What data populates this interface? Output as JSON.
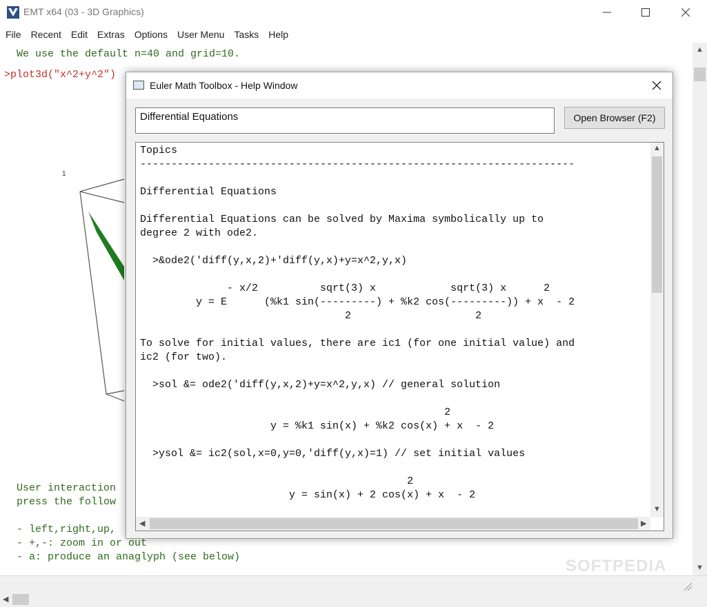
{
  "window": {
    "title": "EMT x64 (03 - 3D Graphics)"
  },
  "menu": [
    "File",
    "Recent",
    "Edit",
    "Extras",
    "Options",
    "User Menu",
    "Tasks",
    "Help"
  ],
  "notebook": {
    "line1": "We use the default n=40 and grid=10.",
    "cmd": ">plot3d(\"x^2+y^2\")",
    "plot_label": "1",
    "ui1": "User interaction",
    "ui2": "press the follow",
    "ui3": "- left,right,up,",
    "ui4": "- +,-: zoom in or out",
    "ui5": "- a: produce an anaglyph (see below)"
  },
  "watermark": "SOFTPEDIA",
  "help": {
    "title": "Euler Math Toolbox - Help Window",
    "search_value": "Differential Equations",
    "open_button": "Open Browser (F2)",
    "lines": [
      "Topics",
      "----------------------------------------------------------------------",
      "",
      "Differential Equations",
      "",
      "Differential Equations can be solved by Maxima symbolically up to",
      "degree 2 with ode2.",
      "",
      "  >&ode2('diff(y,x,2)+'diff(y,x)+y=x^2,y,x)",
      "",
      "              - x/2          sqrt(3) x            sqrt(3) x      2",
      "         y = E      (%k1 sin(---------) + %k2 cos(---------)) + x  - 2",
      "                                 2                    2",
      "",
      "To solve for initial values, there are ic1 (for one initial value) and",
      "ic2 (for two).",
      "",
      "  >sol &= ode2('diff(y,x,2)+y=x^2,y,x) // general solution",
      "",
      "                                                 2",
      "                     y = %k1 sin(x) + %k2 cos(x) + x  - 2",
      "",
      "  >ysol &= ic2(sol,x=0,y=0,'diff(y,x)=1) // set initial values",
      "",
      "                                           2",
      "                        y = sin(x) + 2 cos(x) + x  - 2"
    ]
  }
}
